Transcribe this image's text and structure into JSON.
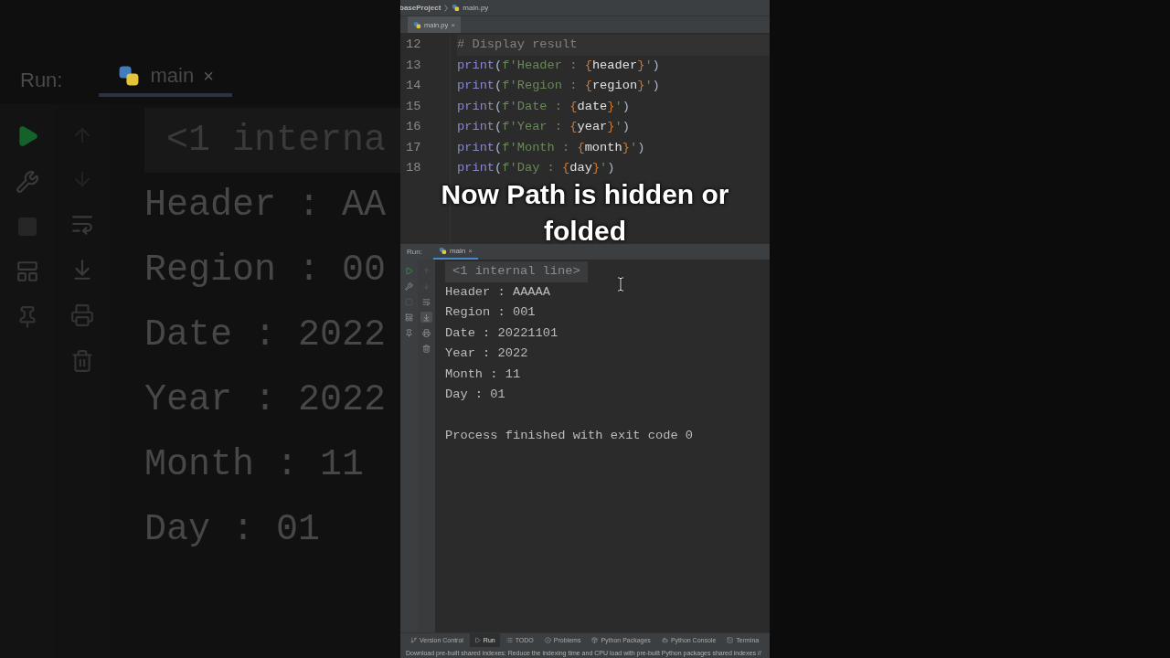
{
  "backdrop": {
    "title": "Run:",
    "tab": "main",
    "close": "×",
    "lines": [
      {
        "kind": "folded",
        "text": "<1 interna"
      },
      {
        "kind": "output",
        "text": "Header : AA"
      },
      {
        "kind": "output",
        "text": "Region : 00"
      },
      {
        "kind": "output",
        "text": "Date : 2022"
      },
      {
        "kind": "output",
        "text": "Year : 2022"
      },
      {
        "kind": "output",
        "text": "Month : 11"
      },
      {
        "kind": "output",
        "text": "Day : 01"
      }
    ]
  },
  "breadcrumb": {
    "project": "baseProject",
    "file": "main.py"
  },
  "editor_tabs": [
    {
      "label": "main.py",
      "selected": true,
      "close": "×"
    }
  ],
  "code_lines": [
    {
      "number": "12",
      "tokens": [
        {
          "kind": "comment",
          "text": "# Display result"
        }
      ]
    },
    {
      "number": "13",
      "tokens": [
        {
          "kind": "func",
          "text": "print"
        },
        {
          "kind": "plain",
          "text": "("
        },
        {
          "kind": "string",
          "text": "f'Header : "
        },
        {
          "kind": "brace",
          "text": "{"
        },
        {
          "kind": "var",
          "text": "header"
        },
        {
          "kind": "brace",
          "text": "}"
        },
        {
          "kind": "string",
          "text": "'"
        },
        {
          "kind": "plain",
          "text": ")"
        }
      ]
    },
    {
      "number": "14",
      "tokens": [
        {
          "kind": "func",
          "text": "print"
        },
        {
          "kind": "plain",
          "text": "("
        },
        {
          "kind": "string",
          "text": "f'Region : "
        },
        {
          "kind": "brace",
          "text": "{"
        },
        {
          "kind": "var",
          "text": "region"
        },
        {
          "kind": "brace",
          "text": "}"
        },
        {
          "kind": "string",
          "text": "'"
        },
        {
          "kind": "plain",
          "text": ")"
        }
      ]
    },
    {
      "number": "15",
      "tokens": [
        {
          "kind": "func",
          "text": "print"
        },
        {
          "kind": "plain",
          "text": "("
        },
        {
          "kind": "string",
          "text": "f'Date : "
        },
        {
          "kind": "brace",
          "text": "{"
        },
        {
          "kind": "var",
          "text": "date"
        },
        {
          "kind": "brace",
          "text": "}"
        },
        {
          "kind": "string",
          "text": "'"
        },
        {
          "kind": "plain",
          "text": ")"
        }
      ]
    },
    {
      "number": "16",
      "tokens": [
        {
          "kind": "func",
          "text": "print"
        },
        {
          "kind": "plain",
          "text": "("
        },
        {
          "kind": "string",
          "text": "f'Year : "
        },
        {
          "kind": "brace",
          "text": "{"
        },
        {
          "kind": "var",
          "text": "year"
        },
        {
          "kind": "brace",
          "text": "}"
        },
        {
          "kind": "string",
          "text": "'"
        },
        {
          "kind": "plain",
          "text": ")"
        }
      ]
    },
    {
      "number": "17",
      "tokens": [
        {
          "kind": "func",
          "text": "print"
        },
        {
          "kind": "plain",
          "text": "("
        },
        {
          "kind": "string",
          "text": "f'Month : "
        },
        {
          "kind": "brace",
          "text": "{"
        },
        {
          "kind": "var",
          "text": "month"
        },
        {
          "kind": "brace",
          "text": "}"
        },
        {
          "kind": "string",
          "text": "'"
        },
        {
          "kind": "plain",
          "text": ")"
        }
      ]
    },
    {
      "number": "18",
      "tokens": [
        {
          "kind": "func",
          "text": "print"
        },
        {
          "kind": "plain",
          "text": "("
        },
        {
          "kind": "string",
          "text": "f'Day : "
        },
        {
          "kind": "brace",
          "text": "{"
        },
        {
          "kind": "var",
          "text": "day"
        },
        {
          "kind": "brace",
          "text": "}"
        },
        {
          "kind": "string",
          "text": "'"
        },
        {
          "kind": "plain",
          "text": ")"
        }
      ]
    }
  ],
  "caption": "Now Path is hidden or folded",
  "run_panel": {
    "title": "Run:",
    "tabs": [
      {
        "label": "main",
        "selected": true,
        "close": "×"
      }
    ],
    "autoscroll_on": true,
    "console": [
      {
        "kind": "folded",
        "text": "<1 internal line>"
      },
      {
        "kind": "output",
        "text": "Header : AAAAA"
      },
      {
        "kind": "output",
        "text": "Region : 001"
      },
      {
        "kind": "output",
        "text": "Date : 20221101"
      },
      {
        "kind": "output",
        "text": "Year : 2022"
      },
      {
        "kind": "output",
        "text": "Month : 11"
      },
      {
        "kind": "output",
        "text": "Day : 01"
      },
      {
        "kind": "exit",
        "text": "Process finished with exit code 0"
      }
    ]
  },
  "tool_windows": [
    {
      "label": "Version Control",
      "selected": false
    },
    {
      "label": "Run",
      "selected": true
    },
    {
      "label": "TODO",
      "selected": false
    },
    {
      "label": "Problems",
      "selected": false
    },
    {
      "label": "Python Packages",
      "selected": false
    },
    {
      "label": "Python Console",
      "selected": false
    },
    {
      "label": "Termina",
      "selected": false
    }
  ],
  "status_message": "Download pre-built shared indexes: Reduce the indexing time and CPU load with pre-built Python packages shared indexes //"
}
